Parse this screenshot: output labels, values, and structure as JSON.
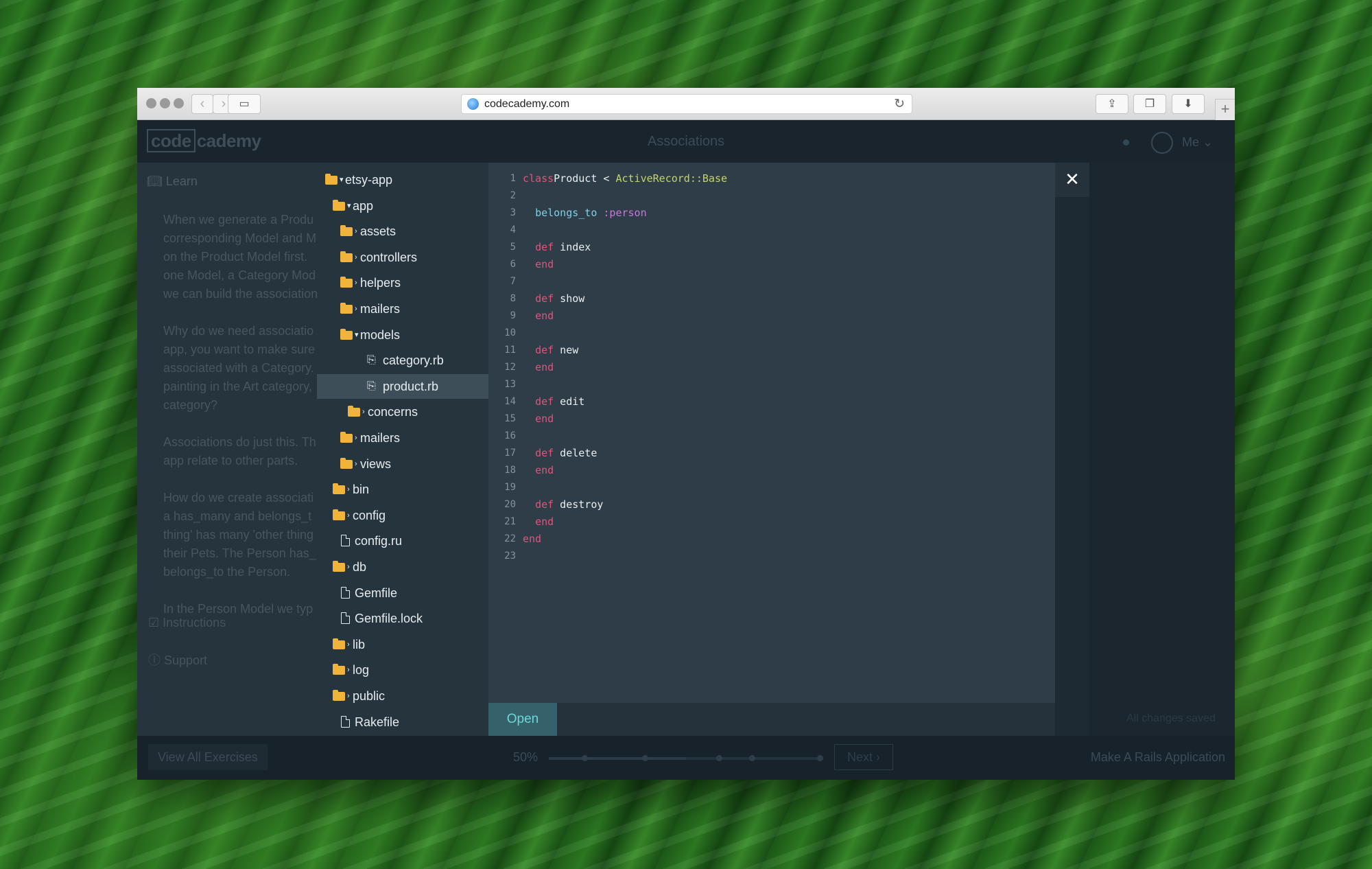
{
  "browser": {
    "url": "codecademy.com"
  },
  "app": {
    "logo_boxed": "code",
    "logo_rest": "cademy",
    "header_title": "Associations",
    "user_label": "Me"
  },
  "lesson": {
    "learn_label": "Learn",
    "paragraphs": [
      [
        "When we generate a Produ",
        "corresponding Model and M",
        "on the Product Model first. ",
        "one Model, a Category Mod",
        "we can build the association"
      ],
      [
        "Why do we need associatio",
        "app, you want to make sure",
        "associated with a Category.",
        "painting in the Art category,",
        "category?"
      ],
      [
        "Associations do just this. Th",
        "app relate to other parts."
      ],
      [
        "How do we create associati",
        "a has_many and belongs_t",
        "thing' has many 'other thing",
        "their Pets. The Person has_r",
        "belongs_to the Person."
      ],
      [
        "In the Person Model we typ"
      ]
    ],
    "instructions_label": "Instructions",
    "support_label": "Support"
  },
  "filetree": [
    {
      "name": "etsy-app",
      "type": "folder",
      "state": "open",
      "depth": 0
    },
    {
      "name": "app",
      "type": "folder",
      "state": "open",
      "depth": 1
    },
    {
      "name": "assets",
      "type": "folder",
      "state": "closed",
      "depth": 2
    },
    {
      "name": "controllers",
      "type": "folder",
      "state": "closed",
      "depth": 2
    },
    {
      "name": "helpers",
      "type": "folder",
      "state": "closed",
      "depth": 2
    },
    {
      "name": "mailers",
      "type": "folder",
      "state": "closed",
      "depth": 2
    },
    {
      "name": "models",
      "type": "folder",
      "state": "open",
      "depth": 2
    },
    {
      "name": "category.rb",
      "type": "ruby",
      "state": "",
      "depth": 3
    },
    {
      "name": "product.rb",
      "type": "ruby",
      "state": "",
      "depth": 3,
      "selected": true
    },
    {
      "name": "concerns",
      "type": "folder",
      "state": "closed",
      "depth": 3
    },
    {
      "name": "mailers",
      "type": "folder",
      "state": "closed",
      "depth": 2
    },
    {
      "name": "views",
      "type": "folder",
      "state": "closed",
      "depth": 2
    },
    {
      "name": "bin",
      "type": "folder",
      "state": "closed",
      "depth": 1
    },
    {
      "name": "config",
      "type": "folder",
      "state": "closed",
      "depth": 1
    },
    {
      "name": "config.ru",
      "type": "file",
      "state": "",
      "depth": 1
    },
    {
      "name": "db",
      "type": "folder",
      "state": "closed",
      "depth": 1
    },
    {
      "name": "Gemfile",
      "type": "file",
      "state": "",
      "depth": 1
    },
    {
      "name": "Gemfile.lock",
      "type": "file",
      "state": "",
      "depth": 1
    },
    {
      "name": "lib",
      "type": "folder",
      "state": "closed",
      "depth": 1
    },
    {
      "name": "log",
      "type": "folder",
      "state": "closed",
      "depth": 1
    },
    {
      "name": "public",
      "type": "folder",
      "state": "closed",
      "depth": 1
    },
    {
      "name": "Rakefile",
      "type": "file",
      "state": "",
      "depth": 1
    }
  ],
  "editor": {
    "lines": [
      [
        [
          "kw",
          "class"
        ],
        [
          "",
          "Product < "
        ],
        [
          "cls",
          "ActiveRecord::Base"
        ]
      ],
      [],
      [
        [
          "",
          "  "
        ],
        [
          "fn",
          "belongs_to"
        ],
        [
          "",
          ""
        ],
        [
          "sym",
          " :person"
        ]
      ],
      [],
      [
        [
          "",
          "  "
        ],
        [
          "kw",
          "def"
        ],
        [
          "",
          " index"
        ]
      ],
      [
        [
          "",
          "  "
        ],
        [
          "kw",
          "end"
        ]
      ],
      [],
      [
        [
          "",
          "  "
        ],
        [
          "kw",
          "def"
        ],
        [
          "",
          " show"
        ]
      ],
      [
        [
          "",
          "  "
        ],
        [
          "kw",
          "end"
        ]
      ],
      [],
      [
        [
          "",
          "  "
        ],
        [
          "kw",
          "def"
        ],
        [
          "",
          " new"
        ]
      ],
      [
        [
          "",
          "  "
        ],
        [
          "kw",
          "end"
        ]
      ],
      [],
      [
        [
          "",
          "  "
        ],
        [
          "kw",
          "def"
        ],
        [
          "",
          " edit"
        ]
      ],
      [
        [
          "",
          "  "
        ],
        [
          "kw",
          "end"
        ]
      ],
      [],
      [
        [
          "",
          "  "
        ],
        [
          "kw",
          "def"
        ],
        [
          "",
          " delete"
        ]
      ],
      [
        [
          "",
          "  "
        ],
        [
          "kw",
          "end"
        ]
      ],
      [],
      [
        [
          "",
          "  "
        ],
        [
          "kw",
          "def"
        ],
        [
          "",
          " destroy"
        ]
      ],
      [
        [
          "",
          "  "
        ],
        [
          "kw",
          "end"
        ]
      ],
      [
        [
          "kw",
          "end"
        ]
      ],
      []
    ],
    "open_label": "Open",
    "close_glyph": "✕"
  },
  "status": {
    "saved_label": "All changes saved"
  },
  "bottom": {
    "view_all_label": "View All Exercises",
    "percent_label": "50%",
    "progress_fraction": 0.5,
    "next_label": "Next ›",
    "course_label": "Make A Rails Application"
  },
  "icons": {
    "folder": "folder-icon",
    "file": "file-icon",
    "ruby": "ruby-file-icon"
  }
}
